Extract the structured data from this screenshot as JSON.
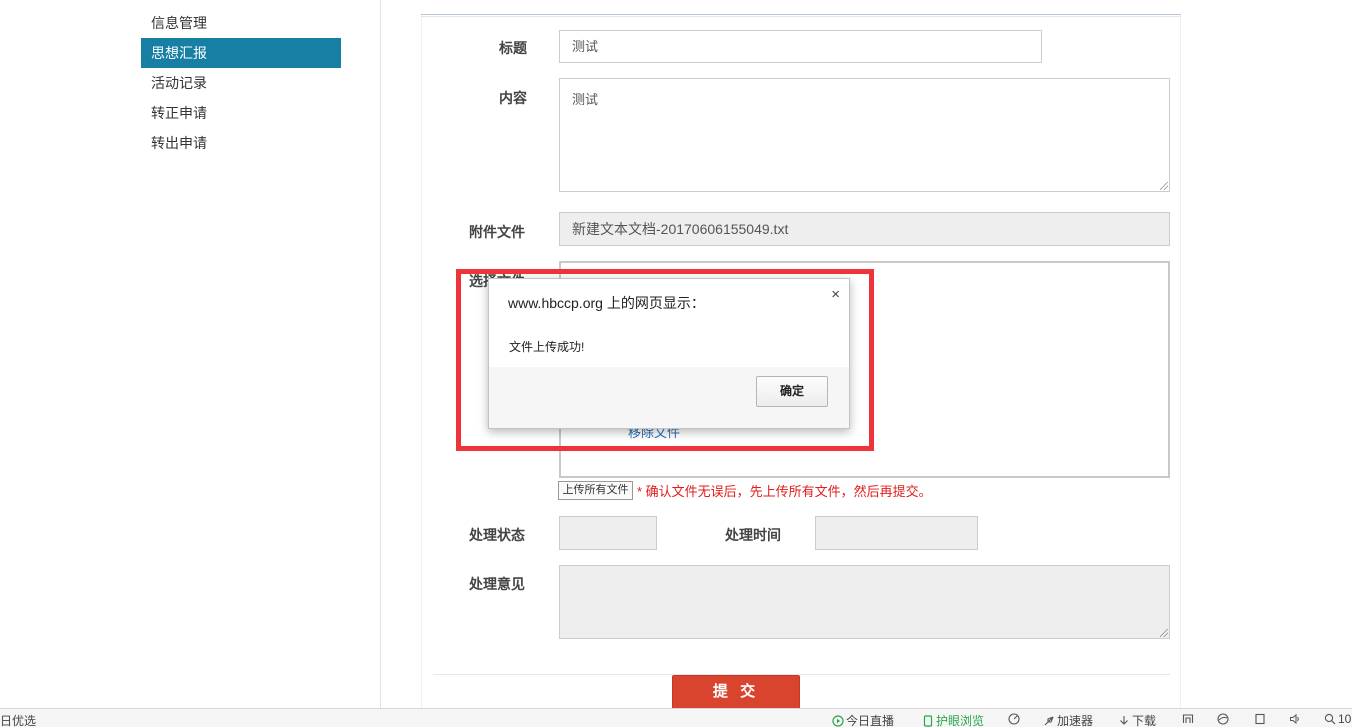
{
  "sidebar": {
    "items": [
      {
        "label": "信息管理",
        "active": false
      },
      {
        "label": "思想汇报",
        "active": true
      },
      {
        "label": "活动记录",
        "active": false
      },
      {
        "label": "转正申请",
        "active": false
      },
      {
        "label": "转出申请",
        "active": false
      }
    ]
  },
  "form": {
    "title_label": "标题",
    "title_value": "测试",
    "content_label": "内容",
    "content_value": "测试",
    "attachment_label": "附件文件",
    "attachment_value": "新建文本文档-20170606155049.txt",
    "choose_file_label_partial": "选择文件",
    "remove_file_link": "移除文件",
    "upload_all_button": "上传所有文件",
    "upload_note": "* 确认文件无误后，先上传所有文件，然后再提交。",
    "status_label": "处理状态",
    "status_value": "",
    "time_label": "处理时间",
    "time_value": "",
    "opinion_label": "处理意见",
    "opinion_value": "",
    "submit_button": "提 交"
  },
  "dialog": {
    "title": "www.hbccp.org 上的网页显示：",
    "close_symbol": "×",
    "message": "文件上传成功!",
    "ok_button": "确定",
    "highlight_color": "#ee333b"
  },
  "statusbar": {
    "left_text": "日优选",
    "items": [
      {
        "label": "今日直播",
        "icon": "play-circle-icon"
      },
      {
        "label": "护眼浏览",
        "icon": "eye-care-icon",
        "color": "#2aa54d"
      },
      {
        "label": "",
        "icon": "speedometer-icon"
      },
      {
        "label": "加速器",
        "icon": "rocket-icon"
      },
      {
        "label": "下载",
        "icon": "download-icon"
      },
      {
        "label": "",
        "icon": "screenshot-icon"
      },
      {
        "label": "",
        "icon": "browser-icon"
      },
      {
        "label": "",
        "icon": "window-icon"
      },
      {
        "label": "",
        "icon": "volume-icon"
      },
      {
        "label": "10",
        "icon": "zoom-icon"
      }
    ]
  },
  "colors": {
    "sidebar_active": "#167fa3",
    "submit": "#d9442f",
    "note_red": "#e21c1c",
    "link_blue": "#2a6db5"
  }
}
